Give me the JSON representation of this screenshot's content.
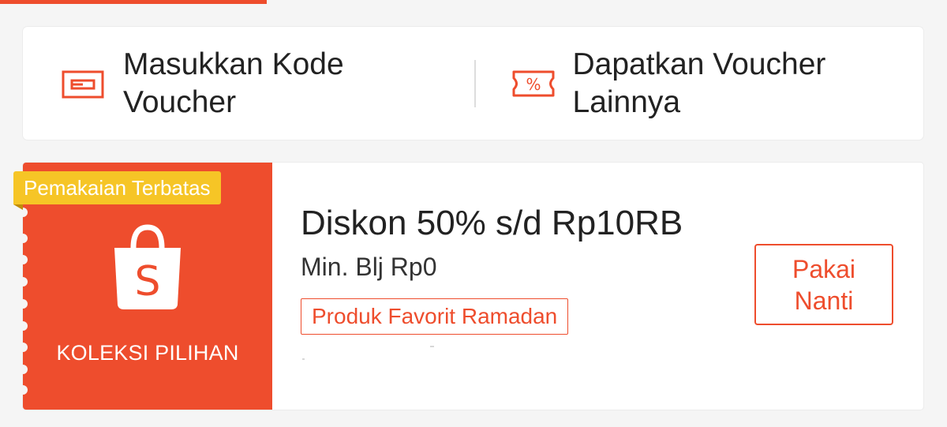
{
  "colors": {
    "accent": "#ee4d2d",
    "badge": "#f6c526",
    "background": "#f5f5f5"
  },
  "voucher_actions": {
    "enter_code": {
      "label": "Masukkan Kode\nVoucher",
      "icon": "voucher-card-icon"
    },
    "get_more": {
      "label": "Dapatkan Voucher\nLainnya",
      "icon": "percent-ticket-icon"
    }
  },
  "voucher": {
    "badge": "Pemakaian Terbatas",
    "logo_icon": "shopee-bag-icon",
    "logo_letter": "S",
    "collection_label": "KOLEKSI PILIHAN",
    "title": "Diskon 50% s/d Rp10RB",
    "min_spend": "Min. Blj Rp0",
    "category_tag": "Produk Favorit Ramadan",
    "action_button": "Pakai\nNanti"
  }
}
